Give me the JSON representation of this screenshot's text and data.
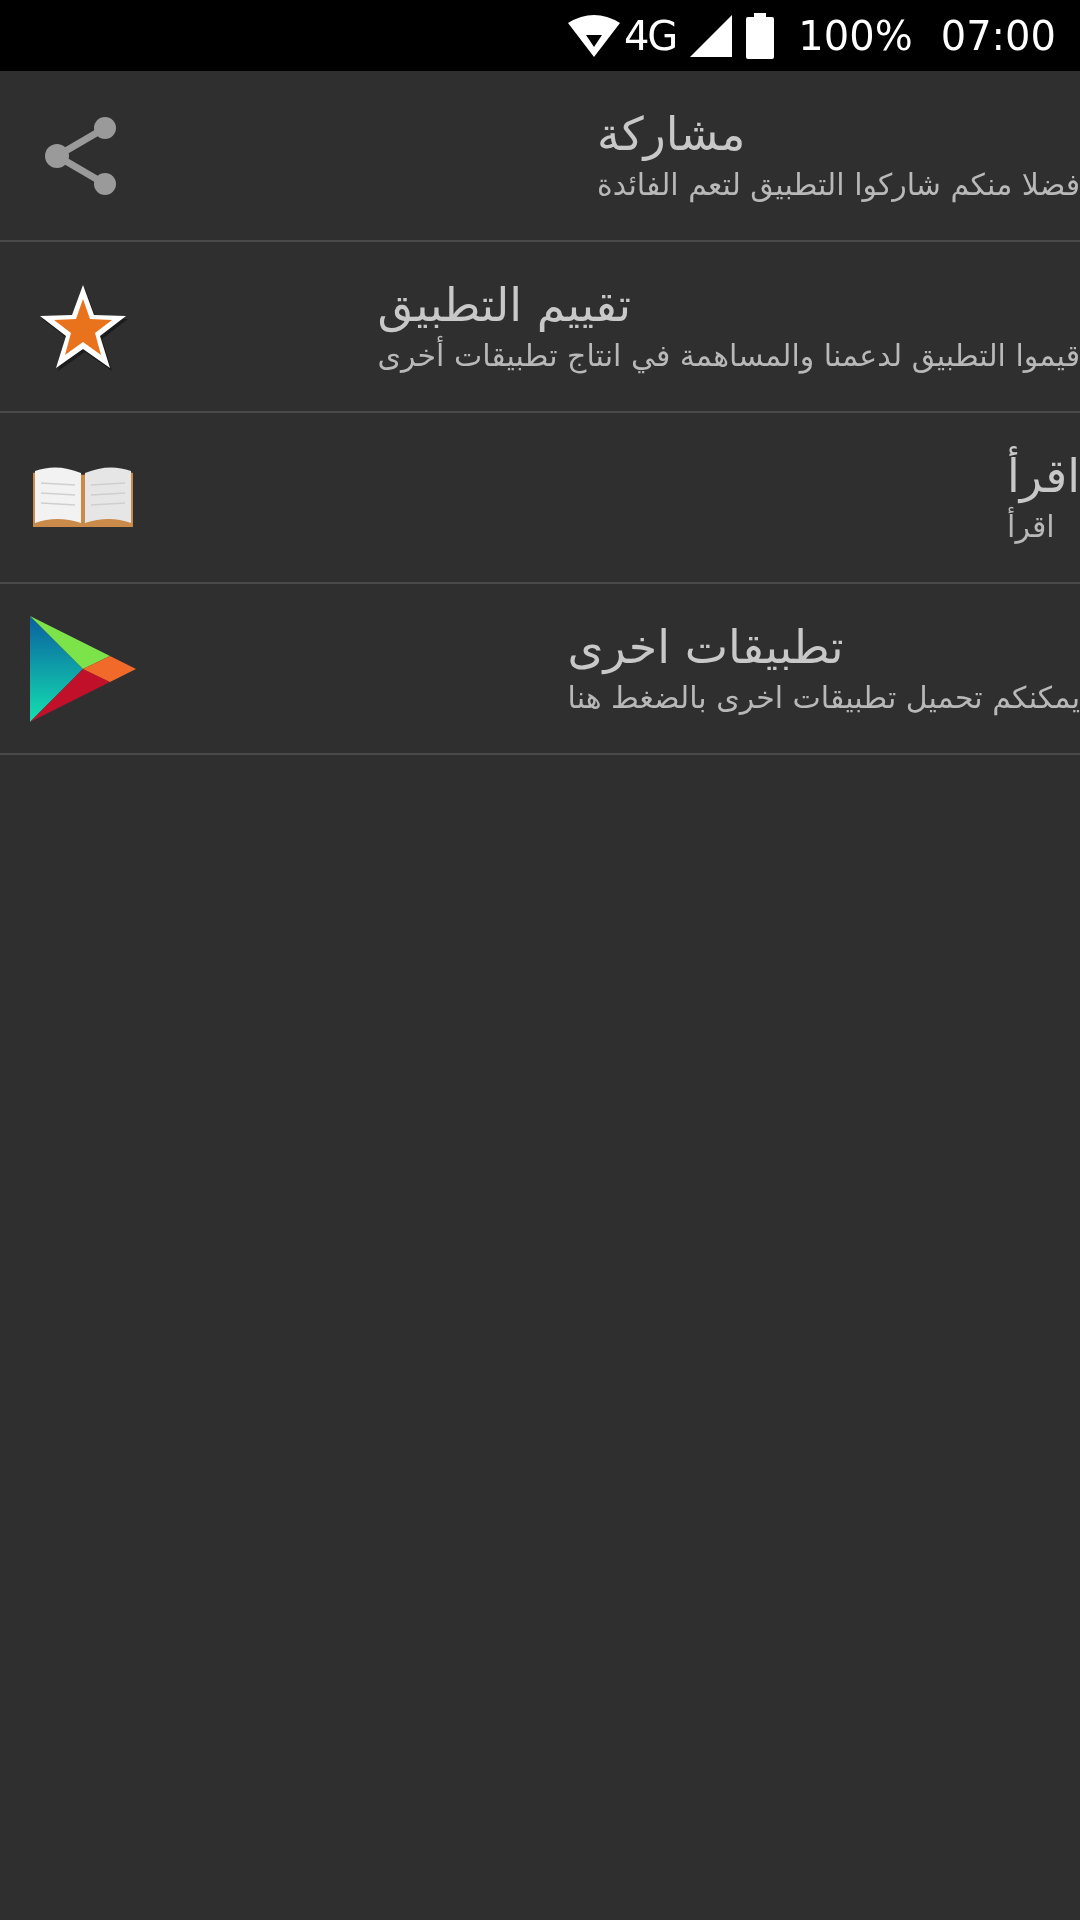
{
  "status_bar": {
    "network": "4G",
    "battery": "100%",
    "time": "07:00"
  },
  "items": [
    {
      "kind": "share",
      "title": "مشاركة",
      "subtitle": "فضلا منكم شاركوا التطبيق لتعم الفائدة"
    },
    {
      "kind": "star",
      "title": "تقييم التطبيق",
      "subtitle": "قيموا التطبيق لدعمنا والمساهمة في انتاج تطبيقات أخرى"
    },
    {
      "kind": "book",
      "title": "اقرأ",
      "subtitle": "اقرأ"
    },
    {
      "kind": "store",
      "title": "تطبيقات اخرى",
      "subtitle": "يمكنكم تحميل تطبيقات اخرى بالضغط هنا"
    }
  ]
}
